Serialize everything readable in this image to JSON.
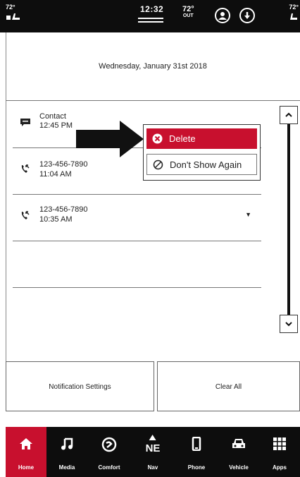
{
  "status_bar": {
    "left_temp": "72°",
    "right_temp": "72°",
    "clock": "12:32",
    "outside_temp": "72°",
    "outside_label": "OUT"
  },
  "date_header": "Wednesday, January 31st 2018",
  "notifications": [
    {
      "icon": "message-icon",
      "title": "Contact",
      "time": "12:45 PM"
    },
    {
      "icon": "phone-incoming-icon",
      "title": "123-456-7890",
      "time": "11:04 AM"
    },
    {
      "icon": "phone-incoming-icon",
      "title": "123-456-7890",
      "time": "10:35 AM"
    }
  ],
  "context_menu": {
    "delete_label": "Delete",
    "dont_show_label": "Don't Show Again"
  },
  "buttons": {
    "notification_settings": "Notification Settings",
    "clear_all": "Clear All"
  },
  "nav": {
    "items": [
      {
        "label": "Home",
        "icon": "home-icon",
        "active": true
      },
      {
        "label": "Media",
        "icon": "music-note-icon"
      },
      {
        "label": "Comfort",
        "icon": "climate-icon"
      },
      {
        "label": "Nav",
        "icon": "compass-icon",
        "glyph_text": "NE"
      },
      {
        "label": "Phone",
        "icon": "phone-icon"
      },
      {
        "label": "Vehicle",
        "icon": "car-icon"
      },
      {
        "label": "Apps",
        "icon": "apps-grid-icon"
      }
    ]
  },
  "colors": {
    "accent": "#c8102e",
    "bar_background": "#0d0d0d"
  }
}
